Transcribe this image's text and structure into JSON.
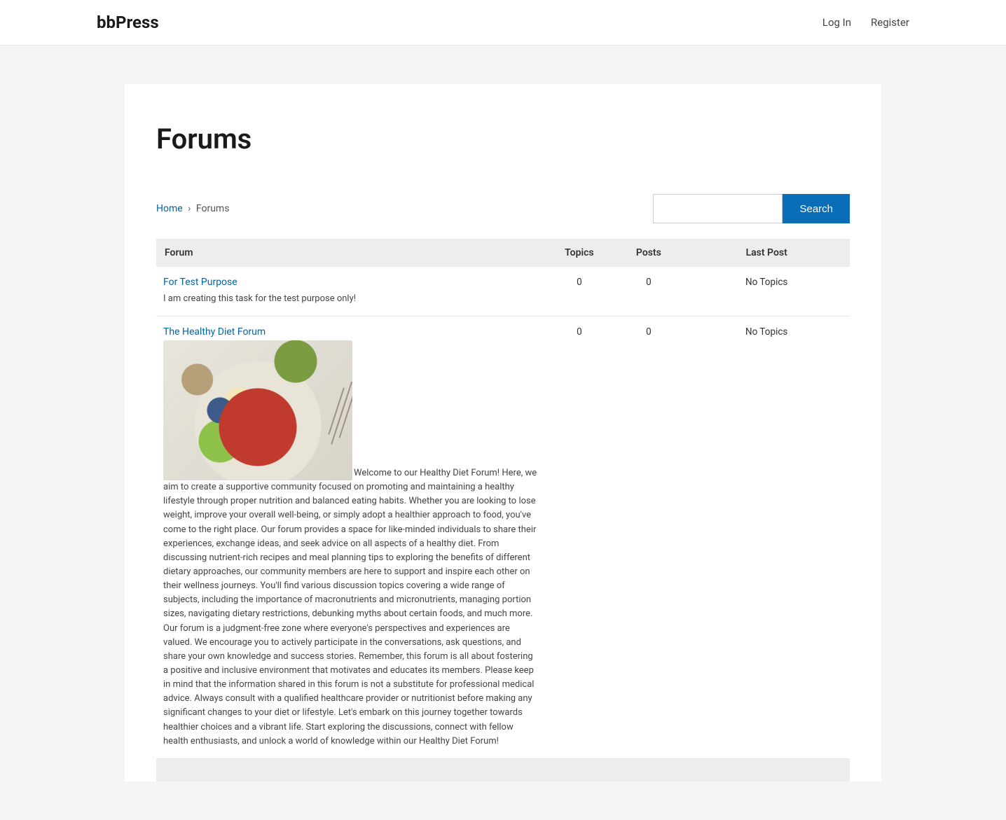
{
  "header": {
    "site_title": "bbPress",
    "nav": {
      "login": "Log In",
      "register": "Register"
    }
  },
  "page": {
    "title": "Forums"
  },
  "breadcrumb": {
    "home_label": "Home",
    "sep": "›",
    "current": "Forums"
  },
  "search": {
    "button_label": "Search",
    "placeholder": ""
  },
  "table": {
    "headers": {
      "forum": "Forum",
      "topics": "Topics",
      "posts": "Posts",
      "last_post": "Last Post"
    },
    "rows": [
      {
        "title": "For Test Purpose",
        "description": "I am creating this task for the test purpose only!",
        "topics": "0",
        "posts": "0",
        "last_post": "No Topics",
        "has_image": false
      },
      {
        "title": "The Healthy Diet Forum",
        "description": "Welcome to our Healthy Diet Forum! Here, we aim to create a supportive community focused on promoting and maintaining a healthy lifestyle through proper nutrition and balanced eating habits. Whether you are looking to lose weight, improve your overall well-being, or simply adopt a healthier approach to food, you've come to the right place. Our forum provides a space for like-minded individuals to share their experiences, exchange ideas, and seek advice on all aspects of a healthy diet. From discussing nutrient-rich recipes and meal planning tips to exploring the benefits of different dietary approaches, our community members are here to support and inspire each other on their wellness journeys. You'll find various discussion topics covering a wide range of subjects, including the importance of macronutrients and micronutrients, managing portion sizes, navigating dietary restrictions, debunking myths about certain foods, and much more. Our forum is a judgment-free zone where everyone's perspectives and experiences are valued. We encourage you to actively participate in the conversations, ask questions, and share your own knowledge and success stories. Remember, this forum is all about fostering a positive and inclusive environment that motivates and educates its members. Please keep in mind that the information shared in this forum is not a substitute for professional medical advice. Always consult with a qualified healthcare provider or nutritionist before making any significant changes to your diet or lifestyle. Let's embark on this journey together towards healthier choices and a vibrant life. Start exploring the discussions, connect with fellow health enthusiasts, and unlock a world of knowledge within our Healthy Diet Forum!",
        "topics": "0",
        "posts": "0",
        "last_post": "No Topics",
        "has_image": true
      }
    ]
  }
}
